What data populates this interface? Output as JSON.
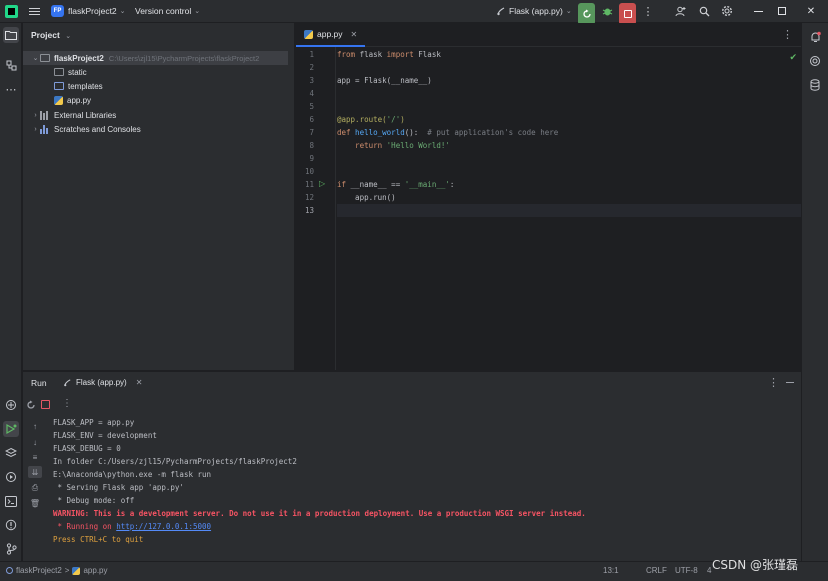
{
  "titlebar": {
    "project_badge": "FP",
    "project_name": "flaskProject2",
    "vcs_label": "Version control",
    "run_config": "Flask (app.py)"
  },
  "project_panel": {
    "title": "Project",
    "tree": [
      {
        "label": "flaskProject2",
        "path": "C:\\Users\\zjl15\\PycharmProjects\\flaskProject2",
        "type": "root-folder",
        "expanded": true
      },
      {
        "label": "static",
        "type": "folder"
      },
      {
        "label": "templates",
        "type": "folder-templates"
      },
      {
        "label": "app.py",
        "type": "python-file"
      },
      {
        "label": "External Libraries",
        "type": "libraries"
      },
      {
        "label": "Scratches and Consoles",
        "type": "scratches"
      }
    ]
  },
  "editor": {
    "tab_label": "app.py",
    "line_numbers": [
      "1",
      "2",
      "3",
      "4",
      "5",
      "6",
      "7",
      "8",
      "9",
      "10",
      "11",
      "12",
      "13"
    ],
    "current_line": 13
  },
  "code": {
    "l1_from": "from",
    "l1_mod": " flask ",
    "l1_import": "import",
    "l1_cls": " Flask",
    "l3": "app = Flask(__name__)",
    "l6_dec": "@app.route(",
    "l6_str": "'/'",
    "l6_end": ")",
    "l7_def": "def",
    "l7_fn": " hello_world",
    "l7_paren": "():",
    "l7_cmt": "  # put application's code here",
    "l8_ret": "    return",
    "l8_str": " 'Hello World!'",
    "l11_if": "if",
    "l11_mid": " __name__ == ",
    "l11_str": "'__main__'",
    "l11_end": ":",
    "l12": "    app.run()"
  },
  "run_window": {
    "title": "Run",
    "tab_label": "Flask (app.py)",
    "console": {
      "line1": "FLASK_APP = app.py",
      "line2": "FLASK_ENV = development",
      "line3": "FLASK_DEBUG = 0",
      "line4": "In folder C:/Users/zjl15/PycharmProjects/flaskProject2",
      "line5": "E:\\Anaconda\\python.exe -m flask run",
      "line6": " * Serving Flask app 'app.py'",
      "line7": " * Debug mode: off",
      "line8": "WARNING: This is a development server. Do not use it in a production deployment. Use a production WSGI server instead.",
      "line9_prefix": " * Running on ",
      "line9_link": "http://127.0.0.1:5000",
      "line10": "Press CTRL+C to quit"
    }
  },
  "statusbar": {
    "breadcrumb_project": "flaskProject2",
    "breadcrumb_sep": ">",
    "breadcrumb_file": "app.py",
    "position": "13:1",
    "line_ending": "CRLF",
    "encoding": "UTF-8",
    "indent": "4"
  },
  "watermark": "CSDN @张瑾磊",
  "colors": {
    "accent": "#3574f0",
    "run_green": "#57965c",
    "stop_red": "#c94f4f",
    "warning_red": "#f75464",
    "link_blue": "#548af7"
  }
}
